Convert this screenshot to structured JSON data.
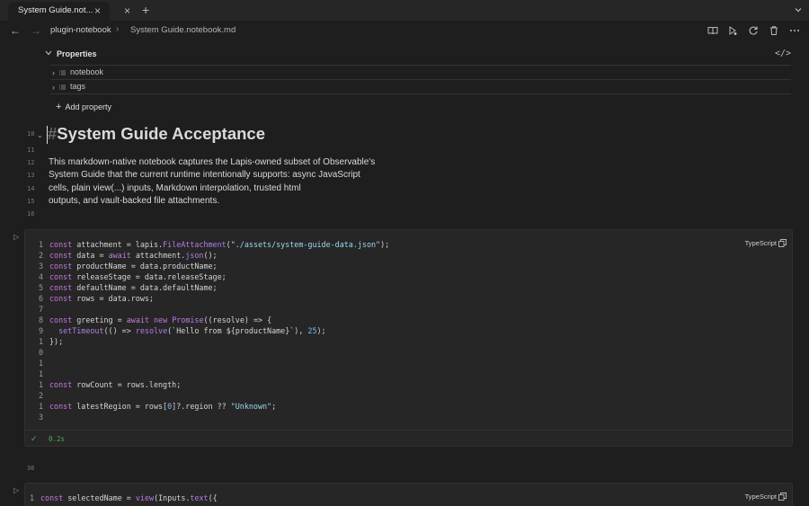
{
  "tabs": [
    {
      "title": "System Guide.not..."
    }
  ],
  "breadcrumb": {
    "folder": "plugin-notebook",
    "file": "System Guide.notebook.md"
  },
  "properties": {
    "title": "Properties",
    "items": [
      "notebook",
      "tags"
    ],
    "add_label": "Add property"
  },
  "editor": {
    "heading_hash": "#",
    "heading": "System Guide Acceptance",
    "heading_line": "10",
    "gutter": [
      "11",
      "12",
      "13",
      "14",
      "15",
      "16"
    ],
    "paragraph": [
      "This markdown-native notebook captures the Lapis-owned subset of Observable's",
      "System Guide that the current runtime intentionally supports: async JavaScript",
      "cells, plain view(...) inputs, Markdown interpolation, trusted html",
      "outputs, and vault-backed file attachments."
    ],
    "between_line": "36"
  },
  "cell1": {
    "language": "TypeScript",
    "line_numbers": [
      "1",
      "2",
      "3",
      "4",
      "5",
      "6",
      "7",
      "8",
      "9",
      "1",
      "0",
      "1",
      "1",
      "1",
      "2",
      "1",
      "3"
    ],
    "status_time": "0.2s"
  },
  "cell2": {
    "language": "TypeScript",
    "line_numbers": [
      "1"
    ]
  },
  "colors": {
    "keyword": "#c678dd",
    "string": "#9cd8f0",
    "number": "#7ab8ff",
    "success": "#4caf50"
  }
}
